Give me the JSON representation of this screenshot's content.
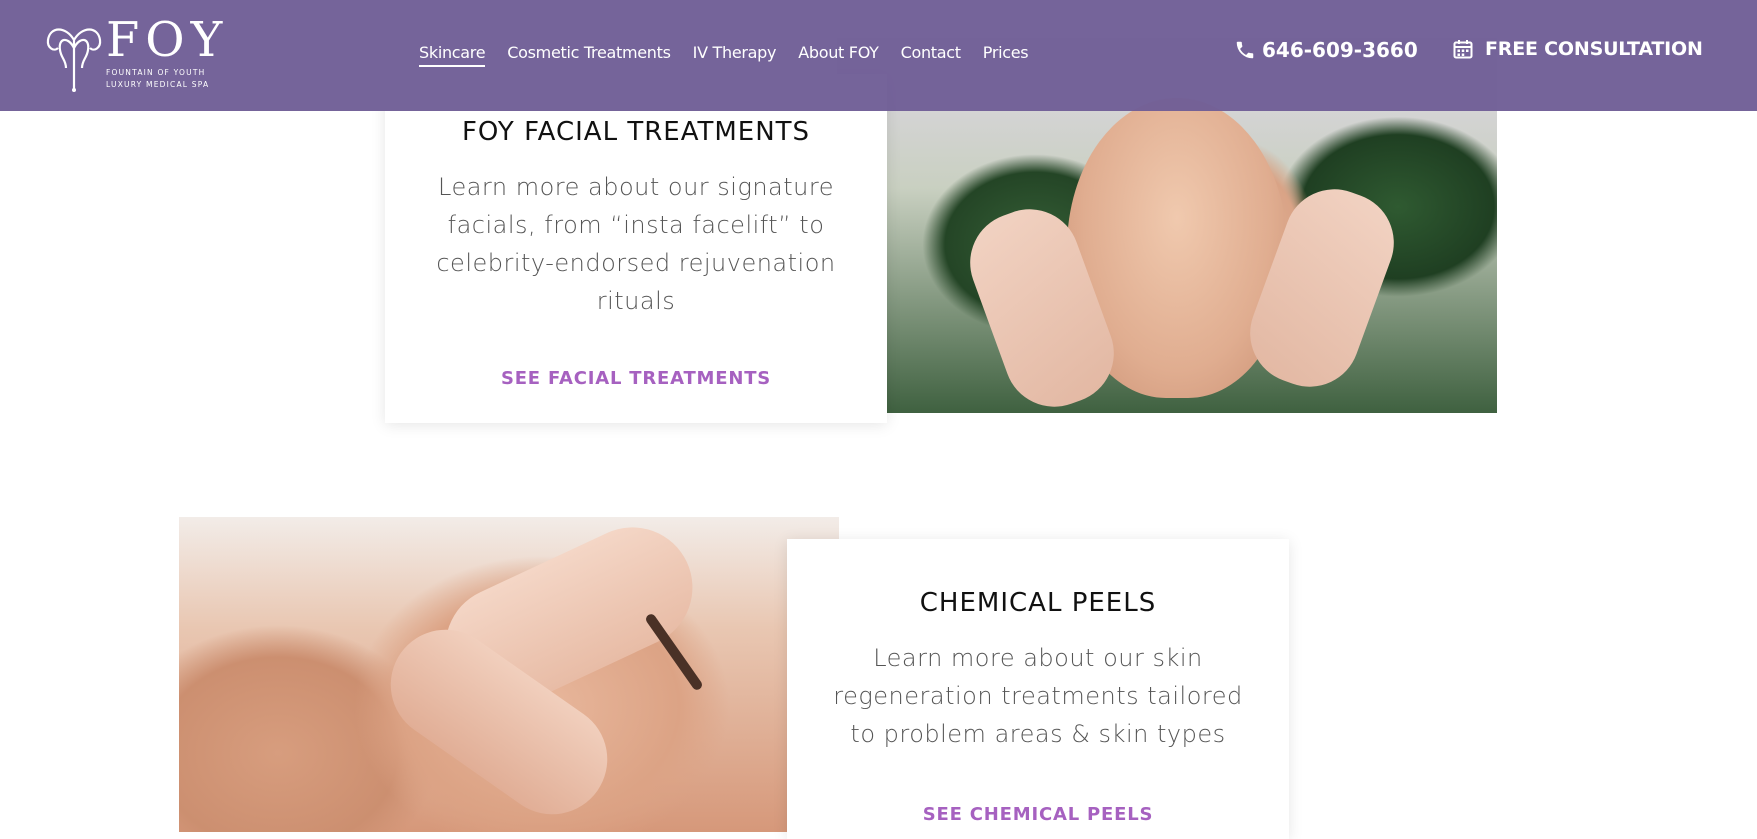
{
  "brand": {
    "name": "FOY",
    "tagline_line1": "FOUNTAIN OF YOUTH",
    "tagline_line2": "LUXURY MEDICAL SPA"
  },
  "nav": {
    "items": [
      {
        "label": "Skincare",
        "active": true
      },
      {
        "label": "Cosmetic Treatments"
      },
      {
        "label": "IV Therapy"
      },
      {
        "label": "About FOY"
      },
      {
        "label": "Contact"
      },
      {
        "label": "Prices"
      }
    ]
  },
  "header": {
    "phone": "646-609-3660",
    "cta": "FREE CONSULTATION"
  },
  "sections": {
    "facial": {
      "title": "FOY FACIAL TREATMENTS",
      "text": "Learn more about our signature facials, from “insta facelift” to celebrity-endorsed rejuvenation rituals",
      "link": "SEE FACIAL TREATMENTS"
    },
    "peels": {
      "title": "CHEMICAL PEELS",
      "text": "Learn more about our skin regeneration treatments tailored to problem areas & skin types",
      "link": "SEE CHEMICAL PEELS"
    }
  },
  "colors": {
    "header_bg": "#6f5e96",
    "accent_link": "#a661c0"
  },
  "icons": {
    "phone": "phone-icon",
    "calendar": "calendar-icon",
    "logo": "fountain-logo-icon"
  }
}
